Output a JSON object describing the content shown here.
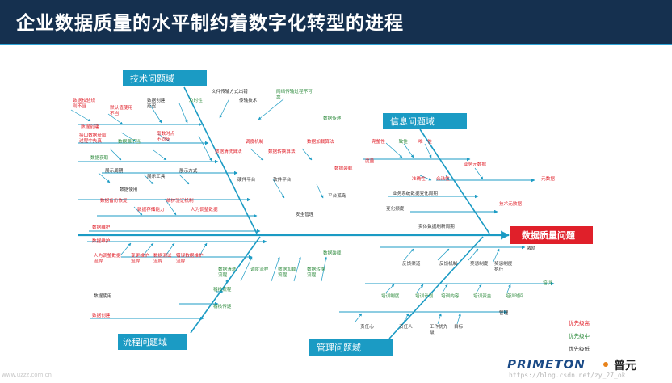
{
  "slide": {
    "title": "企业数据质量的水平制约着数字化转型的进程"
  },
  "diagram": {
    "head": "数据质量问题",
    "domains": {
      "tech": "技术问题域",
      "info": "信息问题域",
      "process": "流程问题域",
      "mgmt": "管理问题域"
    },
    "labels": {
      "t1": "数据校验规则不当",
      "t2": "默认值使用不当",
      "t3": "数据创建延迟",
      "t4": "及时性",
      "t5": "文件传输方式出错",
      "t6": "传输技术",
      "t7": "网络传输过程不可靠",
      "t8": "数据传递",
      "t9": "数据创建",
      "t10": "接口数据获取过程中失真",
      "t11": "数据源不当",
      "t12": "取数时点不同步",
      "t13": "数据获取",
      "t14": "调度机制",
      "t15": "数据清洗算法",
      "t16": "数据转换算法",
      "t17": "数据加载算法",
      "t18": "数据装载",
      "t19": "展示周期",
      "t20": "展示工具",
      "t21": "展示方式",
      "t22": "数据使用",
      "t23": "硬件平台",
      "t24": "软件平台",
      "t25": "数据备份恢复",
      "t26": "维护验证机制",
      "t27": "平台孤岛",
      "t28": "数据存储能力",
      "t29": "人为调整数据",
      "t30": "安全管理",
      "t31": "数据维护",
      "i1": "完整性",
      "i2": "一致性",
      "i3": "唯一性",
      "i4": "度量",
      "i5": "准确性",
      "i6": "合法性",
      "i7": "业务元数据",
      "i8": "元数据",
      "i9": "业务系统数据变化周期",
      "i10": "技术元数据",
      "i11": "变化频度",
      "i12": "实体数据刷新周期",
      "p1": "数据维护",
      "p2": "人为调整数据流程",
      "p3": "变更维护流程",
      "p4": "数据测试流程",
      "p5": "错误数据维护流程",
      "p6": "数据装载",
      "p7": "数据清洗流程",
      "p8": "调度流程",
      "p9": "数据加载流程",
      "p10": "数据转换流程",
      "p11": "数据使用",
      "p12": "稽核流程",
      "p13": "稽核传递",
      "p14": "数据创建",
      "m1": "激励",
      "m2": "反馈渠道",
      "m3": "反馈机制",
      "m4": "奖惩制度",
      "m5": "奖惩制度执行",
      "m6": "培训",
      "m7": "培训制度",
      "m8": "培训计划",
      "m9": "培训内容",
      "m10": "培训资金",
      "m11": "培训时间",
      "m12": "管理",
      "m13": "责任心",
      "m14": "责任人",
      "m15": "工作优先级",
      "m16": "目标"
    },
    "legend": {
      "high": "优先级高",
      "mid": "优先级中",
      "low": "优先级低"
    },
    "colors": {
      "line": "#1b9bc4",
      "red": "#e0202a",
      "green": "#2e8b3d",
      "dark": "#333333",
      "domain_bg": "#1b9bc4"
    }
  },
  "footer": {
    "logo_word": "PRIMETON",
    "logo_cn": "普元",
    "watermark_right": "https://blog.csdn.net/zy_27_ok",
    "watermark_left": "www.uzzz.com.cn"
  }
}
